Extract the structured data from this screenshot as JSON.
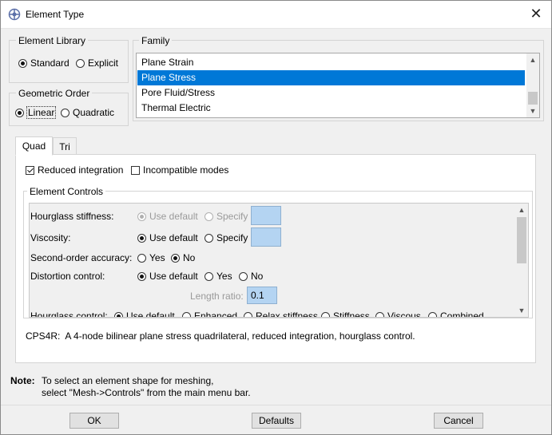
{
  "window": {
    "title": "Element Type"
  },
  "element_library": {
    "legend": "Element Library",
    "options": [
      "Standard",
      "Explicit"
    ],
    "selected": "Standard"
  },
  "geometric_order": {
    "legend": "Geometric Order",
    "options": [
      "Linear",
      "Quadratic"
    ],
    "selected": "Linear"
  },
  "family": {
    "legend": "Family",
    "items": [
      "Plane Strain",
      "Plane Stress",
      "Pore Fluid/Stress",
      "Thermal Electric"
    ],
    "selected": "Plane Stress"
  },
  "tabs": [
    "Quad",
    "Tri"
  ],
  "active_tab": "Quad",
  "quad": {
    "reduced_integration_label": "Reduced integration",
    "reduced_integration_checked": true,
    "incompatible_modes_label": "Incompatible modes",
    "incompatible_modes_checked": false
  },
  "element_controls": {
    "legend": "Element Controls",
    "hourglass_stiffness": {
      "label": "Hourglass stiffness:",
      "opt1": "Use default",
      "opt2": "Specify"
    },
    "viscosity": {
      "label": "Viscosity:",
      "opt1": "Use default",
      "opt2": "Specify"
    },
    "second_order_accuracy": {
      "label": "Second-order accuracy:",
      "opt1": "Yes",
      "opt2": "No"
    },
    "distortion_control": {
      "label": "Distortion control:",
      "opt1": "Use default",
      "opt2": "Yes",
      "opt3": "No"
    },
    "length_ratio": {
      "label": "Length ratio:",
      "value": "0.1"
    },
    "hourglass_control": {
      "label": "Hourglass control:",
      "options": [
        "Use default",
        "Enhanced",
        "Relax stiffness",
        "Stiffness",
        "Viscous",
        "Combined"
      ]
    }
  },
  "description": "CPS4R:  A 4-node bilinear plane stress quadrilateral, reduced integration, hourglass control.",
  "note": {
    "label": "Note:",
    "line1": "To select an element shape for meshing,",
    "line2": "select \"Mesh->Controls\" from the main menu bar."
  },
  "buttons": {
    "ok": "OK",
    "defaults": "Defaults",
    "cancel": "Cancel"
  }
}
